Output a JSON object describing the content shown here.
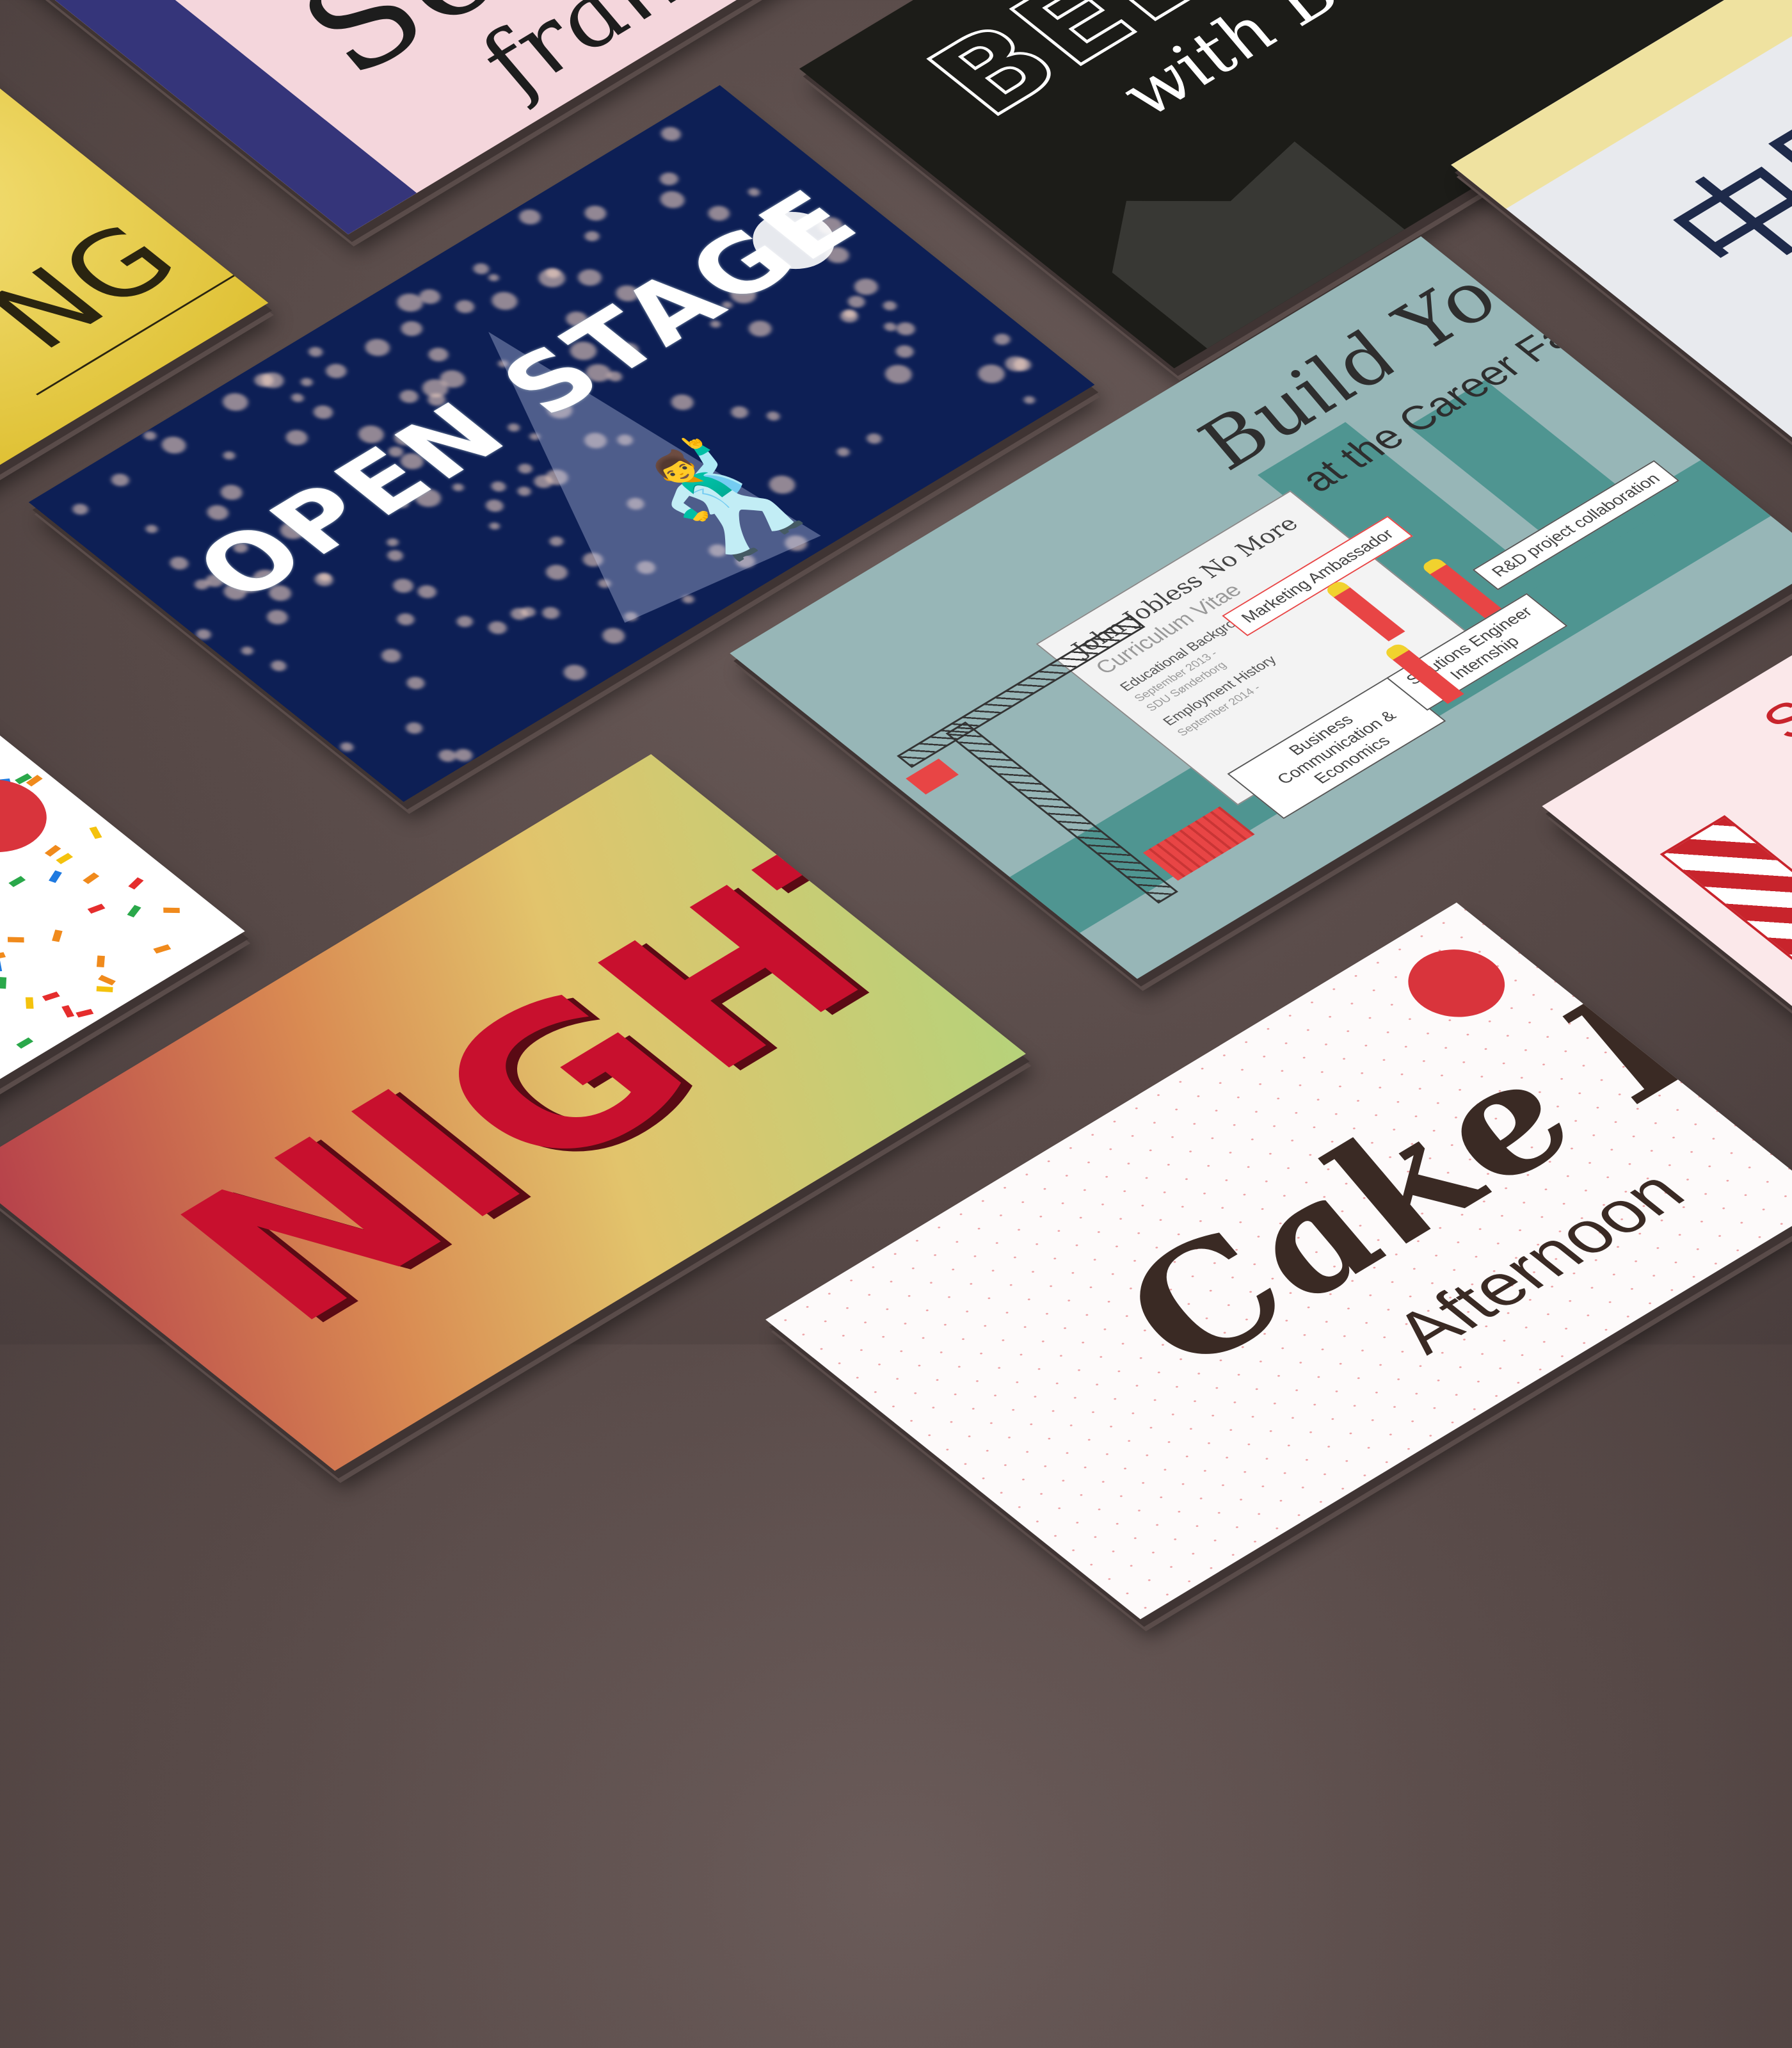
{
  "cards": {
    "french": {
      "title_partial": "So",
      "subtitle": "français",
      "colors": {
        "bg": "#f4d6dc",
        "band": "#35357a"
      }
    },
    "yellow": {
      "title_partial": "NG"
    },
    "confetti": {},
    "open_stage": {
      "title": "OPEN STAGE NIGHT",
      "colors": {
        "bg": "#0d1f55"
      }
    },
    "beer": {
      "title": "BEER",
      "subtitle": "with Brø"
    },
    "chinese": {
      "characters": "中国",
      "subtitle": "Chin"
    },
    "career": {
      "title": "Build Your Future!",
      "subtitle": "at the Career Fair 2014",
      "cv": {
        "name": "John Jobless No More",
        "heading": "Curriculum Vitae",
        "section1": "Educational Background",
        "line1": "September 2013 -",
        "line2": "SDU Sønderborg",
        "section2": "Employment History",
        "line3": "September 2014 -"
      },
      "labels": {
        "marketing": "Marketing Ambassador",
        "rnd": "R&D project collaboration",
        "business": "Business Communication & Economics",
        "solutions": "Solutions Engineer Internship"
      },
      "colors": {
        "bg": "#97b6b7",
        "dark": "#4f9591",
        "accent": "#e84545"
      }
    },
    "night": {
      "title": "NIGHT"
    },
    "cake": {
      "title": "Cake Day",
      "subtitle": "Afternoon",
      "colors": {
        "accent": "#d9343c"
      }
    },
    "pink": {
      "title_partial": "St",
      "letter": "C"
    }
  }
}
